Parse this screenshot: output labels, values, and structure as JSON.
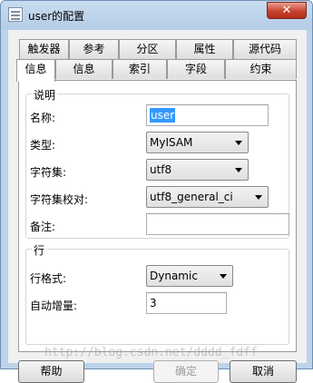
{
  "window": {
    "title": "user的配置",
    "close_glyph": "✕"
  },
  "tabs_back": [
    "触发器",
    "参考",
    "分区",
    "属性",
    "源代码"
  ],
  "tabs_front": [
    "信息",
    "信息",
    "索引",
    "字段",
    "约束"
  ],
  "groups": {
    "description": "说明",
    "row": "行"
  },
  "form": {
    "name_label": "名称:",
    "name_value": "user",
    "type_label": "类型:",
    "type_value": "MyISAM",
    "charset_label": "字符集:",
    "charset_value": "utf8",
    "collation_label": "字符集校对:",
    "collation_value": "utf8_general_ci",
    "comment_label": "备注:",
    "comment_value": "",
    "row_format_label": "行格式:",
    "row_format_value": "Dynamic",
    "auto_inc_label": "自动增量:",
    "auto_inc_value": "3"
  },
  "buttons": {
    "help": "帮助",
    "ok": "确定",
    "cancel": "取消"
  },
  "watermark": "http://blog.csdn.net/dddd_fdff"
}
